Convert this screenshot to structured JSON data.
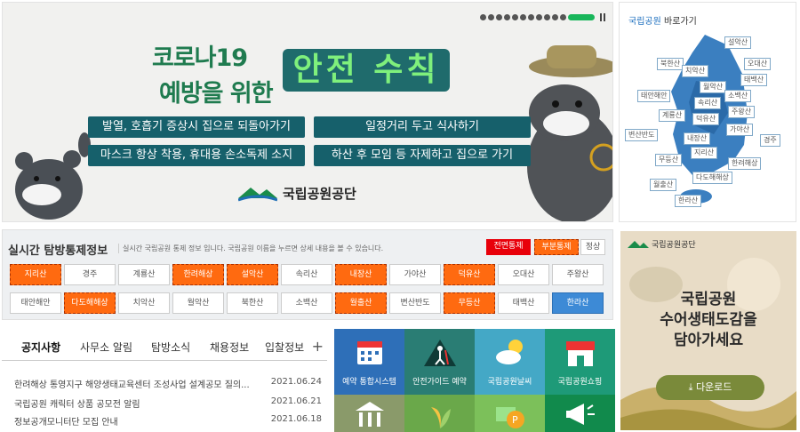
{
  "banner": {
    "line1": "코로나19",
    "line2": "예방을 위한",
    "headline": "안전 수칙",
    "rules": [
      "발열, 호흡기 증상시 집으로 되돌아가기",
      "일정거리 두고 식사하기",
      "마스크 항상 착용, 휴대용 손소독제 소지",
      "하산 후 모임 등 자제하고 집으로 가기"
    ],
    "org": "국립공원공단",
    "slide_count": 12,
    "active_slide": 12
  },
  "map": {
    "title_accent": "국립공원",
    "title_rest": " 바로가기",
    "parks": [
      "설악산",
      "북한산",
      "오대산",
      "치악산",
      "태백산",
      "월악산",
      "태안해안",
      "소백산",
      "속리산",
      "계룡산",
      "주왕산",
      "덕유산",
      "가야산",
      "변산반도",
      "내장산",
      "경주",
      "지리산",
      "무등산",
      "한려해상",
      "월출산",
      "다도해해상",
      "한라산"
    ]
  },
  "control": {
    "title": "실시간 탐방통제정보",
    "desc": "실시간 국립공원 통제 정보 입니다. 국립공원 이름을 누르면 상세 내용을 볼 수 있습니다.",
    "legend": [
      "전면통제",
      "부분통제",
      "정상"
    ],
    "rows": [
      [
        {
          "name": "지리산",
          "s": "partial"
        },
        {
          "name": "경주",
          "s": "normal"
        },
        {
          "name": "계룡산",
          "s": "normal"
        },
        {
          "name": "한려해상",
          "s": "partial"
        },
        {
          "name": "설악산",
          "s": "partial"
        },
        {
          "name": "속리산",
          "s": "normal"
        },
        {
          "name": "내장산",
          "s": "partial"
        },
        {
          "name": "가야산",
          "s": "normal"
        },
        {
          "name": "덕유산",
          "s": "partial"
        },
        {
          "name": "오대산",
          "s": "normal"
        },
        {
          "name": "주왕산",
          "s": "normal"
        }
      ],
      [
        {
          "name": "태안해안",
          "s": "normal"
        },
        {
          "name": "다도해해상",
          "s": "partial"
        },
        {
          "name": "치악산",
          "s": "normal"
        },
        {
          "name": "월악산",
          "s": "normal"
        },
        {
          "name": "북한산",
          "s": "normal"
        },
        {
          "name": "소백산",
          "s": "normal"
        },
        {
          "name": "월출산",
          "s": "partial"
        },
        {
          "name": "변산반도",
          "s": "normal"
        },
        {
          "name": "무등산",
          "s": "partial"
        },
        {
          "name": "태백산",
          "s": "normal"
        },
        {
          "name": "한라산",
          "s": "selected"
        }
      ]
    ]
  },
  "notice": {
    "tabs": [
      "공지사항",
      "사무소 알림",
      "탐방소식",
      "채용정보",
      "입찰정보"
    ],
    "plus": "+",
    "items": [
      {
        "title": "한려해상 통영지구 해양생태교육센터 조성사업 설계공모 질의...",
        "date": "2021.06.24"
      },
      {
        "title": "국립공원 캐릭터 상품 공모전 알림",
        "date": "2021.06.21"
      },
      {
        "title": "정보공개모니터단 모집 안내",
        "date": "2021.06.18"
      }
    ]
  },
  "quick": [
    {
      "label": "예약 통합시스템",
      "color": "#2e6fb8",
      "icon": "calendar-icon"
    },
    {
      "label": "안전가이드 예약",
      "color": "#2a7d74",
      "icon": "hiker-icon"
    },
    {
      "label": "국립공원날씨",
      "color": "#44a8c6",
      "icon": "weather-icon"
    },
    {
      "label": "국립공원쇼핑",
      "color": "#1e9a78",
      "icon": "shop-icon"
    },
    {
      "label": "",
      "color": "#8a9a6a",
      "icon": "building-icon"
    },
    {
      "label": "",
      "color": "#6aa84a",
      "icon": "plant-icon"
    },
    {
      "label": "",
      "color": "#7cc05a",
      "icon": "coin-icon"
    },
    {
      "label": "",
      "color": "#118a4c",
      "icon": "megaphone-icon"
    }
  ],
  "ad": {
    "org": "국립공원공단",
    "title1": "국립공원",
    "title2": "수어생태도감을",
    "title3": "담아가세요",
    "download": "다운로드"
  }
}
